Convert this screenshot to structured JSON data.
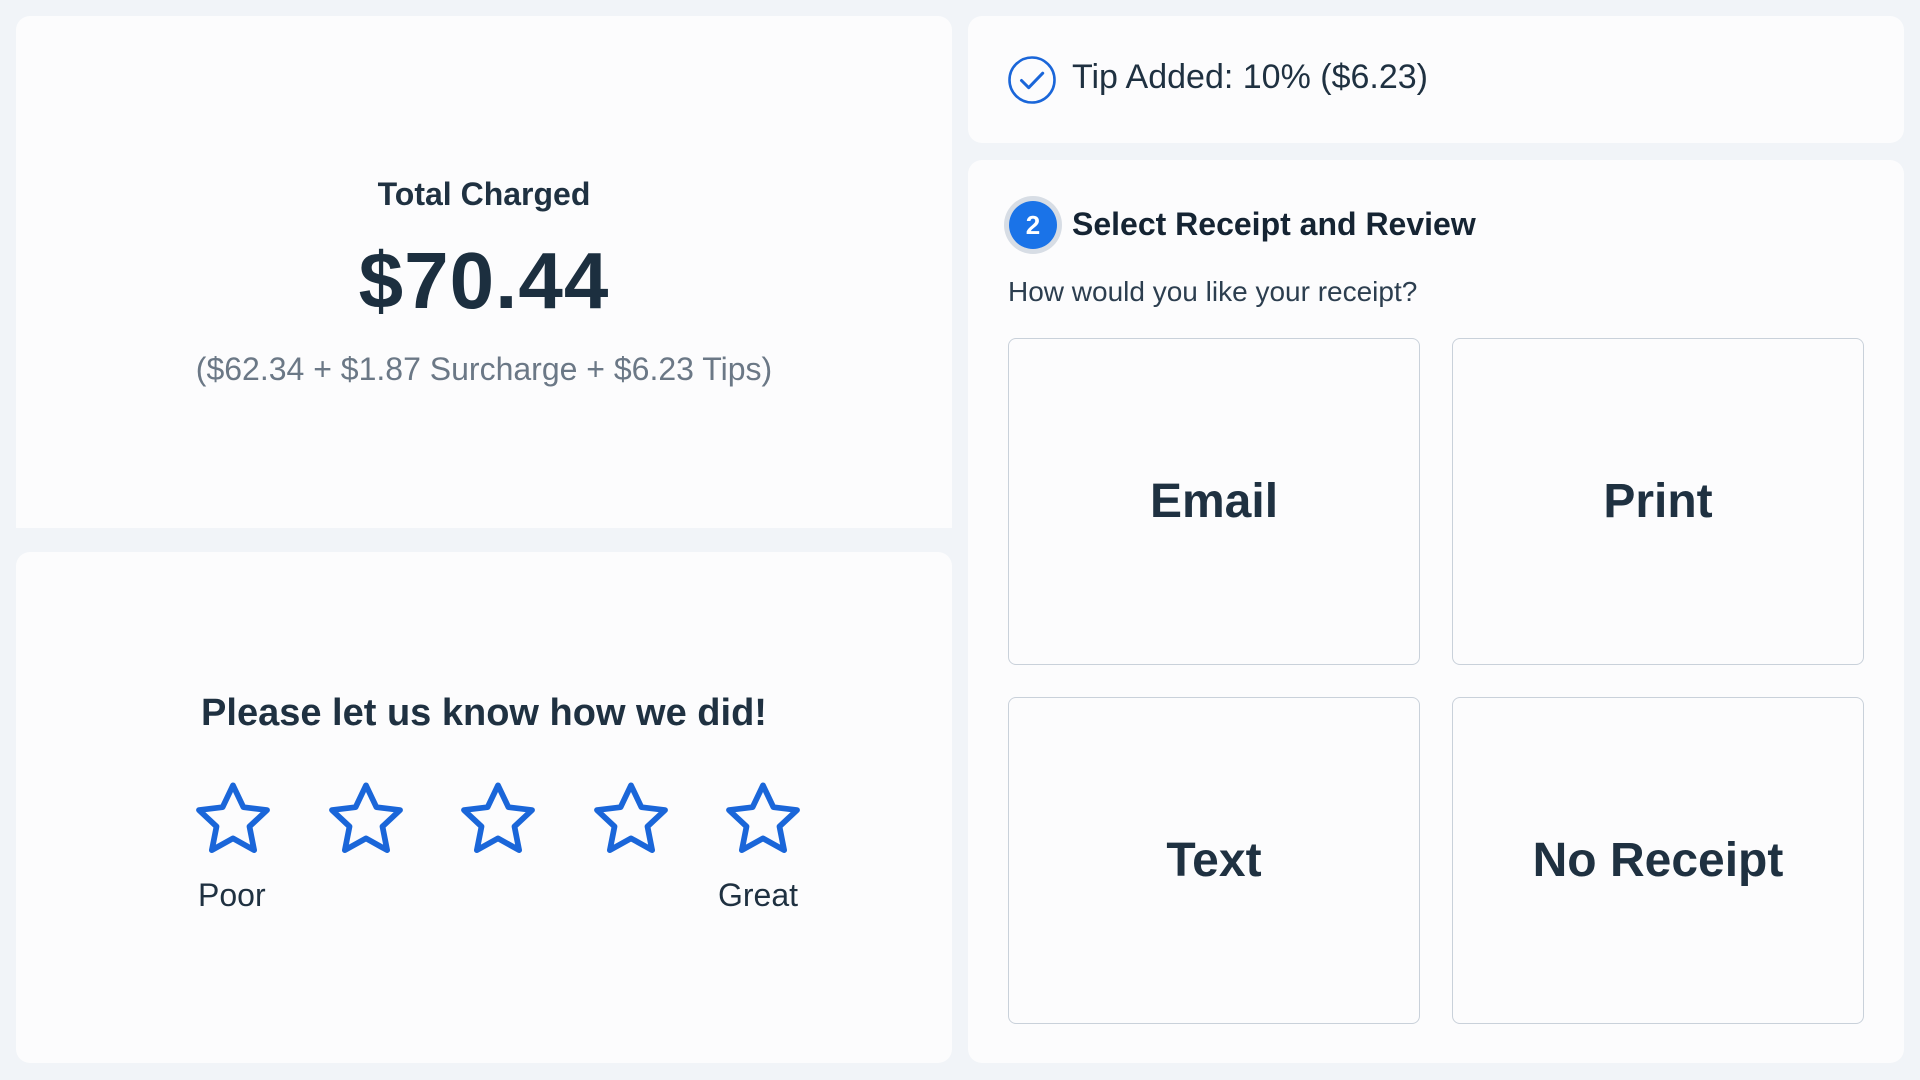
{
  "total": {
    "label": "Total Charged",
    "amount": "$70.44",
    "breakdown": "($62.34 + $1.87 Surcharge + $6.23 Tips)"
  },
  "rating": {
    "title": "Please let us know how we did!",
    "max_stars": 5,
    "selected": 0,
    "low_label": "Poor",
    "high_label": "Great",
    "icon": "star-outline-icon",
    "color": "#1a66d9"
  },
  "tip": {
    "text": "Tip Added: 10% ($6.23)",
    "icon": "check-circle-icon",
    "color": "#1a66d9"
  },
  "receipt": {
    "step_number": "2",
    "title": "Select Receipt and Review",
    "question": "How would you like your receipt?",
    "options": [
      "Email",
      "Print",
      "Text",
      "No Receipt"
    ],
    "accent": "#1a73e8"
  }
}
